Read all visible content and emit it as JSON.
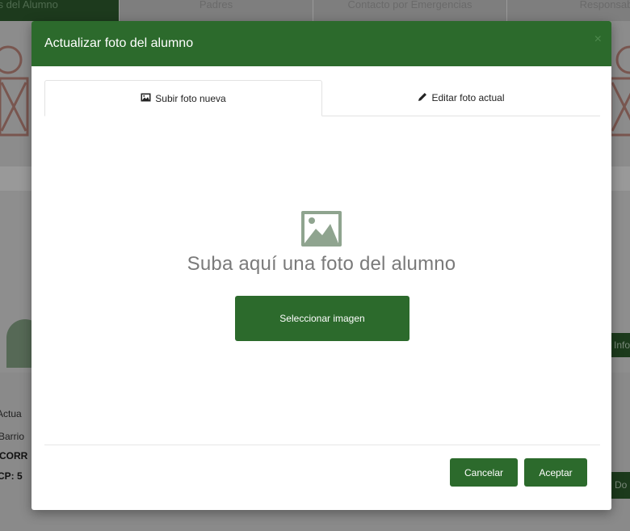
{
  "background": {
    "tabs": [
      {
        "label": "Datos del Alumno"
      },
      {
        "label": "Padres"
      },
      {
        "label": "Contacto por Emergencias"
      },
      {
        "label": "Responsables"
      }
    ],
    "info_button": "Info",
    "doc_button": "Do",
    "text_lines": [
      "Actua",
      "Barrio",
      "CORR",
      "CP: 5"
    ]
  },
  "modal": {
    "title": "Actualizar foto del alumno",
    "close": "×",
    "tabs": [
      {
        "label": "Subir foto nueva",
        "icon": "image-icon"
      },
      {
        "label": "Editar foto actual",
        "icon": "pencil-icon"
      }
    ],
    "upload": {
      "prompt": "Suba aquí una foto del alumno",
      "select_button": "Seleccionar imagen"
    },
    "footer": {
      "cancel": "Cancelar",
      "accept": "Aceptar"
    }
  },
  "colors": {
    "primary": "#2c6a2c",
    "backdrop": "#8a8a8a"
  }
}
